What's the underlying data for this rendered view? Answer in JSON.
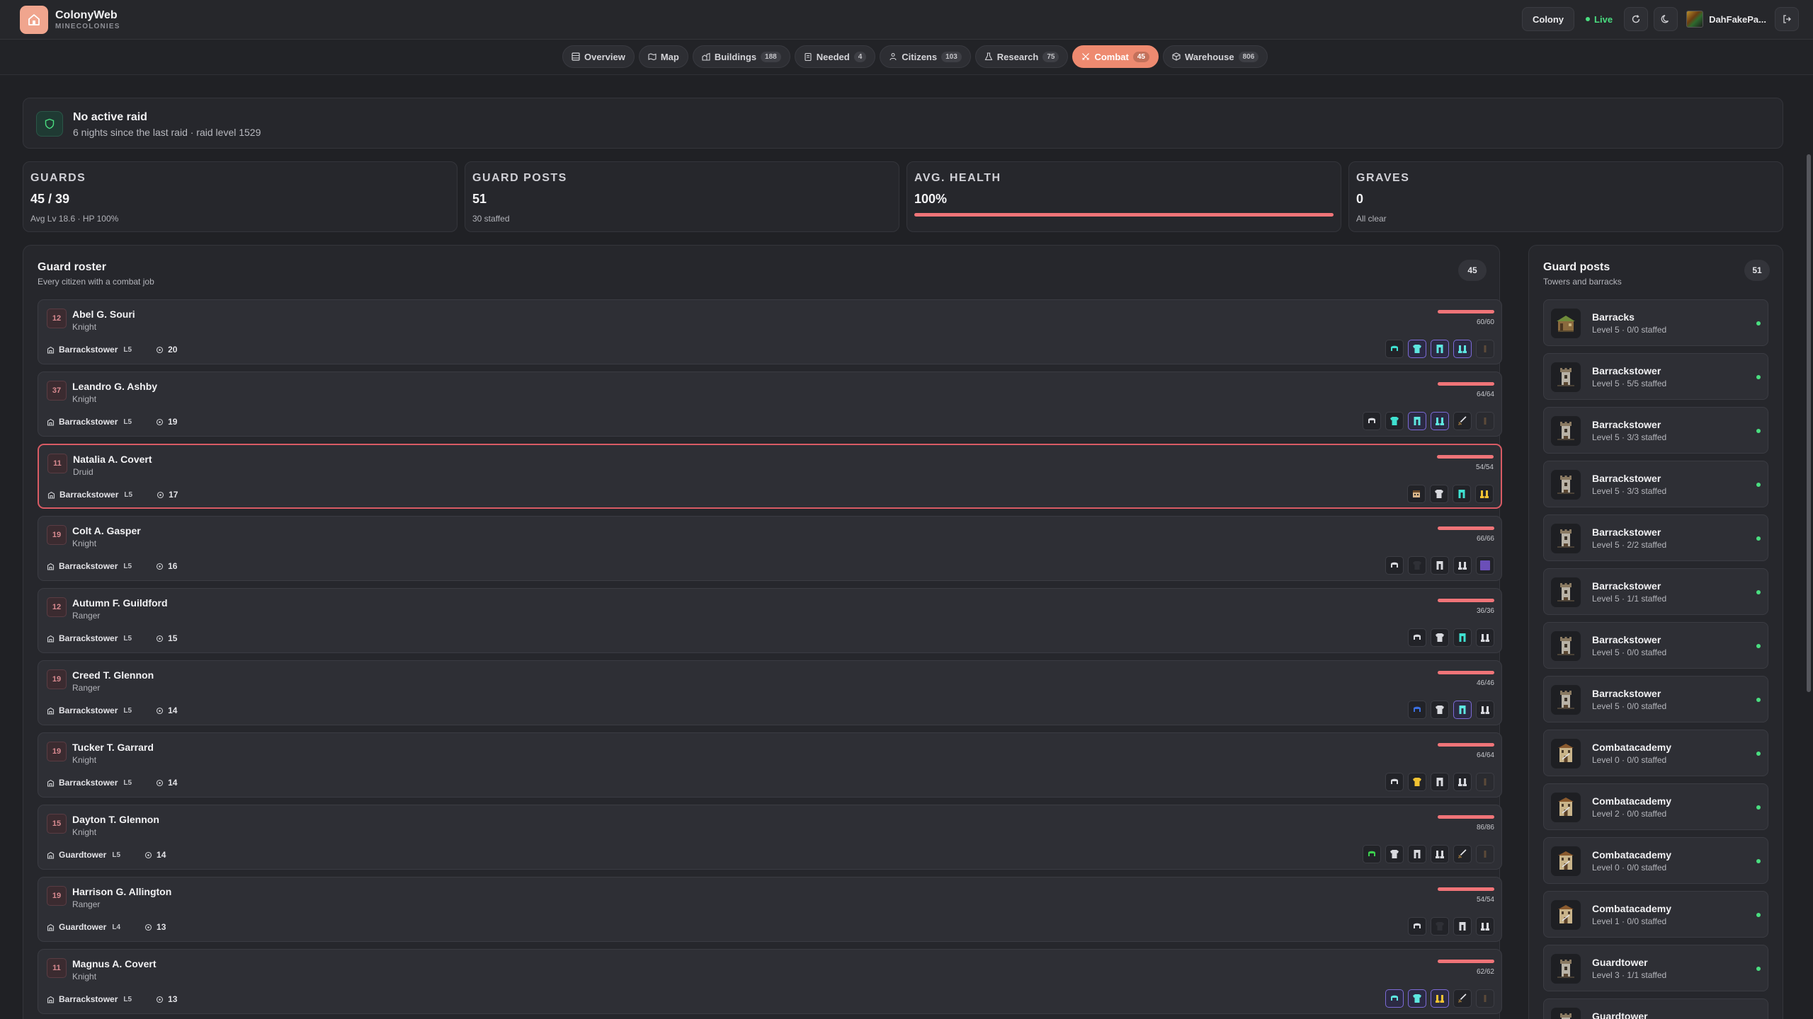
{
  "app": {
    "name": "ColonyWeb",
    "subtitle": "MINECOLONIES"
  },
  "header": {
    "colony_button": "Colony",
    "live_label": "Live",
    "user_name": "DahFakePa..."
  },
  "tabs": [
    {
      "label": "Overview",
      "count": null,
      "icon": "overview-icon"
    },
    {
      "label": "Map",
      "count": null,
      "icon": "map-icon"
    },
    {
      "label": "Buildings",
      "count": "188",
      "icon": "buildings-icon"
    },
    {
      "label": "Needed",
      "count": "4",
      "icon": "clipboard-icon"
    },
    {
      "label": "Citizens",
      "count": "103",
      "icon": "citizens-icon"
    },
    {
      "label": "Research",
      "count": "75",
      "icon": "flask-icon"
    },
    {
      "label": "Combat",
      "count": "45",
      "icon": "swords-icon",
      "active": true
    },
    {
      "label": "Warehouse",
      "count": "806",
      "icon": "box-icon"
    }
  ],
  "raid": {
    "title": "No active raid",
    "subtitle": "6 nights since the last raid · raid level 1529"
  },
  "stats": [
    {
      "label": "GUARDS",
      "value": "45 / 39",
      "sub": "Avg Lv 18.6 · HP 100%"
    },
    {
      "label": "GUARD POSTS",
      "value": "51",
      "sub": "30 staffed"
    },
    {
      "label": "AVG. HEALTH",
      "value": "100%",
      "fraction": 1.0
    },
    {
      "label": "GRAVES",
      "value": "0",
      "sub": "All clear"
    }
  ],
  "roster": {
    "title": "Guard roster",
    "subtitle": "Every citizen with a combat job",
    "count": "45",
    "guards": [
      {
        "level": "12",
        "name": "Abel G. Souri",
        "job": "Knight",
        "building": "Barrackstower",
        "building_level": "L5",
        "kills": "20",
        "hp": "60/60",
        "hp_fraction": 1.0,
        "gear": [
          "helmet-diamond",
          "chest-enchanted",
          "legs-enchanted",
          "boots-enchanted",
          "empty"
        ]
      },
      {
        "level": "37",
        "name": "Leandro G. Ashby",
        "job": "Knight",
        "building": "Barrackstower",
        "building_level": "L5",
        "kills": "19",
        "hp": "64/64",
        "hp_fraction": 1.0,
        "gear": [
          "helmet-iron",
          "chest-diamond",
          "legs-enchanted",
          "boots-enchanted",
          "sword",
          "empty"
        ]
      },
      {
        "level": "11",
        "name": "Natalia A. Covert",
        "job": "Druid",
        "building": "Barrackstower",
        "building_level": "L5",
        "kills": "17",
        "hp": "54/54",
        "hp_fraction": 1.0,
        "gear": [
          "head-skin",
          "chest-iron",
          "legs-diamond",
          "boots-gold"
        ],
        "selected": true
      },
      {
        "level": "19",
        "name": "Colt A. Gasper",
        "job": "Knight",
        "building": "Barrackstower",
        "building_level": "L5",
        "kills": "16",
        "hp": "66/66",
        "hp_fraction": 1.0,
        "gear": [
          "helmet-iron",
          "chest-dark",
          "legs-iron",
          "boots-iron",
          "shield-purple"
        ]
      },
      {
        "level": "12",
        "name": "Autumn F. Guildford",
        "job": "Ranger",
        "building": "Barrackstower",
        "building_level": "L5",
        "kills": "15",
        "hp": "36/36",
        "hp_fraction": 1.0,
        "gear": [
          "helmet-iron",
          "chest-iron",
          "legs-diamond",
          "boots-iron"
        ]
      },
      {
        "level": "19",
        "name": "Creed T. Glennon",
        "job": "Ranger",
        "building": "Barrackstower",
        "building_level": "L5",
        "kills": "14",
        "hp": "46/46",
        "hp_fraction": 1.0,
        "gear": [
          "helmet-blue",
          "chest-iron",
          "legs-enchanted",
          "boots-iron"
        ]
      },
      {
        "level": "19",
        "name": "Tucker T. Garrard",
        "job": "Knight",
        "building": "Barrackstower",
        "building_level": "L5",
        "kills": "14",
        "hp": "64/64",
        "hp_fraction": 1.0,
        "gear": [
          "helmet-iron",
          "chest-gold",
          "legs-iron",
          "boots-iron",
          "empty"
        ]
      },
      {
        "level": "15",
        "name": "Dayton T. Glennon",
        "job": "Knight",
        "building": "Guardtower",
        "building_level": "L5",
        "kills": "14",
        "hp": "86/86",
        "hp_fraction": 1.0,
        "gear": [
          "helmet-green",
          "chest-iron",
          "legs-iron",
          "boots-iron",
          "sword",
          "empty"
        ]
      },
      {
        "level": "19",
        "name": "Harrison G. Allington",
        "job": "Ranger",
        "building": "Guardtower",
        "building_level": "L4",
        "kills": "13",
        "hp": "54/54",
        "hp_fraction": 1.0,
        "gear": [
          "helmet-iron",
          "chest-dark",
          "legs-iron",
          "boots-iron"
        ]
      },
      {
        "level": "11",
        "name": "Magnus A. Covert",
        "job": "Knight",
        "building": "Barrackstower",
        "building_level": "L5",
        "kills": "13",
        "hp": "62/62",
        "hp_fraction": 1.0,
        "gear": [
          "helmet-enchanted",
          "chest-enchanted",
          "boots-gold-enchanted",
          "sword",
          "empty"
        ]
      }
    ]
  },
  "posts": {
    "title": "Guard posts",
    "subtitle": "Towers and barracks",
    "count": "51",
    "items": [
      {
        "name": "Barracks",
        "sub": "Level 5 · 0/0 staffed",
        "img": "barracks"
      },
      {
        "name": "Barrackstower",
        "sub": "Level 5 · 5/5 staffed",
        "img": "tower"
      },
      {
        "name": "Barrackstower",
        "sub": "Level 5 · 3/3 staffed",
        "img": "tower"
      },
      {
        "name": "Barrackstower",
        "sub": "Level 5 · 3/3 staffed",
        "img": "tower"
      },
      {
        "name": "Barrackstower",
        "sub": "Level 5 · 2/2 staffed",
        "img": "tower"
      },
      {
        "name": "Barrackstower",
        "sub": "Level 5 · 1/1 staffed",
        "img": "tower"
      },
      {
        "name": "Barrackstower",
        "sub": "Level 5 · 0/0 staffed",
        "img": "tower"
      },
      {
        "name": "Barrackstower",
        "sub": "Level 5 · 0/0 staffed",
        "img": "tower"
      },
      {
        "name": "Combatacademy",
        "sub": "Level 0 · 0/0 staffed",
        "img": "academy"
      },
      {
        "name": "Combatacademy",
        "sub": "Level 2 · 0/0 staffed",
        "img": "academy"
      },
      {
        "name": "Combatacademy",
        "sub": "Level 0 · 0/0 staffed",
        "img": "academy"
      },
      {
        "name": "Combatacademy",
        "sub": "Level 1 · 0/0 staffed",
        "img": "academy"
      },
      {
        "name": "Guardtower",
        "sub": "Level 3 · 1/1 staffed",
        "img": "tower"
      },
      {
        "name": "Guardtower",
        "sub": "",
        "img": "tower"
      }
    ]
  },
  "colors": {
    "accent": "#ee8a70",
    "live": "#4ade80",
    "health": "#f07478",
    "background": "#202125"
  }
}
